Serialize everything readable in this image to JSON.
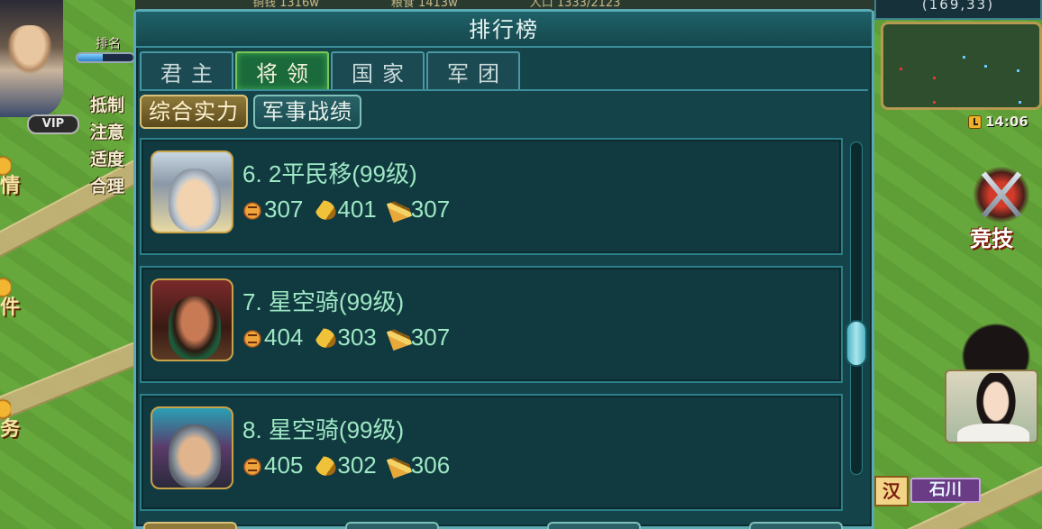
{
  "top_bar": {
    "resources": [
      "铜钱 1316w",
      "粮食 1413w",
      "人口 1333/2123"
    ]
  },
  "player": {
    "rank_label": "排名",
    "vip_label": "VIP",
    "exp_fraction": 0.45,
    "notice_lines": [
      "抵制",
      "注意",
      "适度",
      "合理"
    ]
  },
  "left_menu": [
    {
      "label": "情",
      "icon": "scroll-icon"
    },
    {
      "label": "件",
      "icon": "letter-icon"
    },
    {
      "label": "务",
      "icon": "task-icon"
    }
  ],
  "right_panel": {
    "coords": "(169,33)",
    "clock": "14:06",
    "arena_label": "竞技",
    "faction_tag": "汉",
    "city_name": "石川"
  },
  "ranking": {
    "title": "排行榜",
    "tabs": [
      {
        "label": "君主",
        "active": false
      },
      {
        "label": "将领",
        "active": true
      },
      {
        "label": "国家",
        "active": false
      },
      {
        "label": "军团",
        "active": false
      }
    ],
    "subtabs": [
      {
        "label": "综合实力",
        "active": true
      },
      {
        "label": "军事战绩",
        "active": false
      }
    ],
    "rows": [
      {
        "name": "6. 2平民移(99级)",
        "attack": "307",
        "command": "401",
        "strategy": "307"
      },
      {
        "name": "7. 星空骑(99级)",
        "attack": "404",
        "command": "303",
        "strategy": "307"
      },
      {
        "name": "8. 星空骑(99级)",
        "attack": "405",
        "command": "302",
        "strategy": "306"
      }
    ],
    "scroll_position": 0.62
  },
  "colors": {
    "panel_bg": "#14444a",
    "panel_border": "#59aab5",
    "active_tab": "#1b6a3c",
    "active_subtab": "#8f7a3a",
    "row_text": "#9ee8c4"
  }
}
